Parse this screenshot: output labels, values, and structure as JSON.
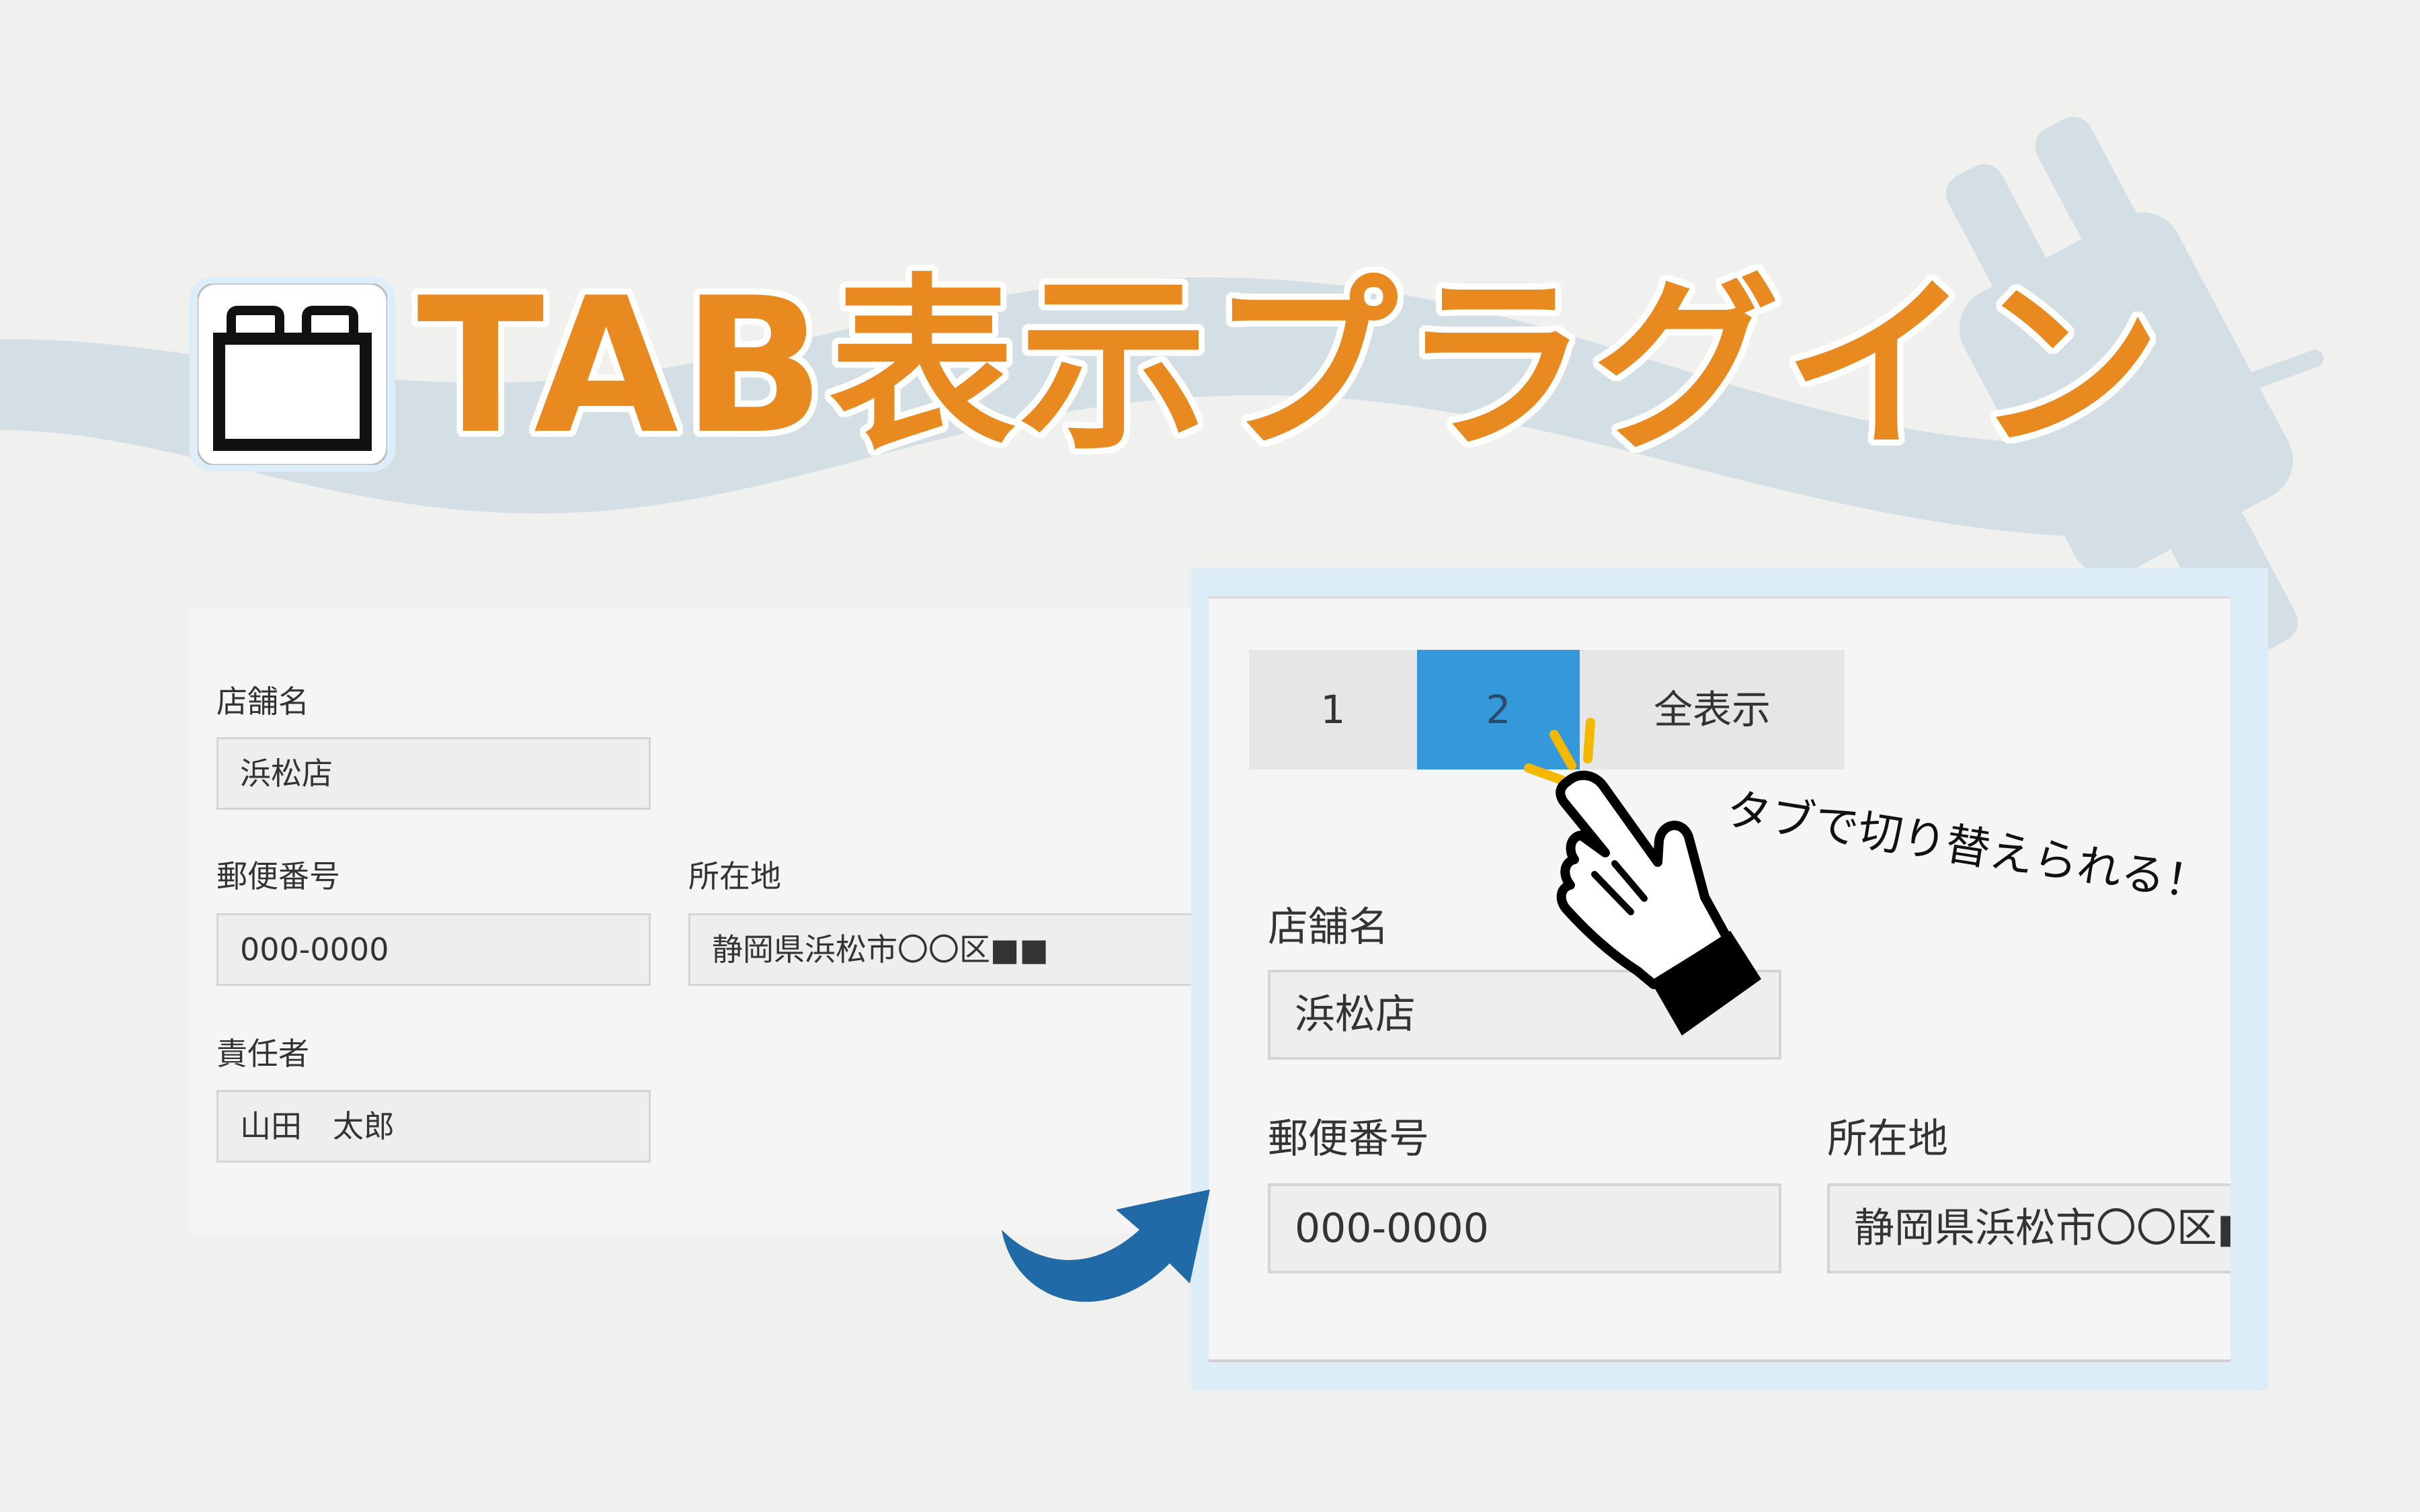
{
  "title": "TAB表示プラグイン",
  "colors": {
    "title_orange": "#e98a21",
    "tab_active": "#3498db",
    "arrow_blue": "#1f6aa7",
    "panel_frame": "#dcedf8",
    "background": "#f0f0ef"
  },
  "icons": {
    "title_icon": "tab-folder-icon",
    "hand": "pointing-hand-icon",
    "arrow": "curved-arrow-icon",
    "sparkle": "click-sparkle-icon"
  },
  "left_form": {
    "store_label": "店舗名",
    "store_value": "浜松店",
    "zip_label": "郵便番号",
    "zip_value": "000-0000",
    "address_label": "所在地",
    "address_value": "静岡県浜松市〇〇区■■",
    "manager_label": "責任者",
    "manager_value": "山田　太郎"
  },
  "right_panel": {
    "tabs": [
      {
        "label": "1",
        "active": false
      },
      {
        "label": "2",
        "active": true
      },
      {
        "label": "全表示",
        "active": false
      }
    ],
    "store_label": "店舗名",
    "store_value": "浜松店",
    "zip_label": "郵便番号",
    "zip_value": "000-0000",
    "address_label": "所在地",
    "address_value": "静岡県浜松市〇〇区■■"
  },
  "annotation": "タブで切り替えられる！"
}
